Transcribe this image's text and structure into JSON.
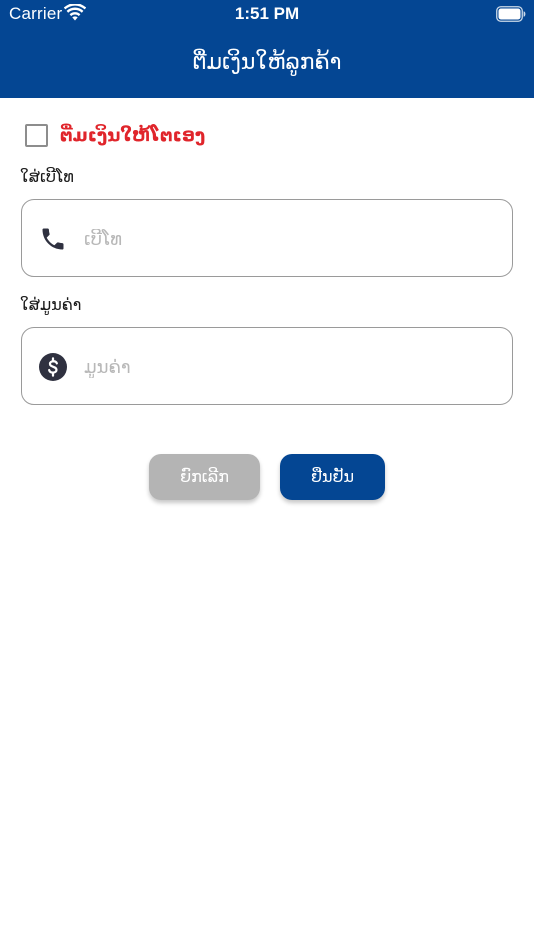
{
  "status_bar": {
    "carrier": "Carrier",
    "time": "1:51 PM",
    "wifi_icon": "wifi-icon",
    "battery_icon": "battery-icon"
  },
  "header": {
    "title": "ຕື່ມເງິນໃຫ້ລູກຄ້າ",
    "background": "#044693"
  },
  "self_topup": {
    "label": "ຕື່ມເງິນໃຫ້ໂຕເອງ",
    "checked": false,
    "label_color": "#e0252b"
  },
  "phone": {
    "label": "ໃສ່ເບີໂທ",
    "placeholder": "ເບີໂທ",
    "value": "",
    "icon": "phone-icon"
  },
  "amount": {
    "label": "ໃສ່ມູນຄ່າ",
    "placeholder": "ມູນຄ່າ",
    "value": "",
    "icon": "dollar-icon"
  },
  "actions": {
    "cancel_label": "ຍົກເລີກ",
    "confirm_label": "ຢືນຢັນ",
    "cancel_color": "#b4b4b4",
    "confirm_color": "#044693"
  }
}
